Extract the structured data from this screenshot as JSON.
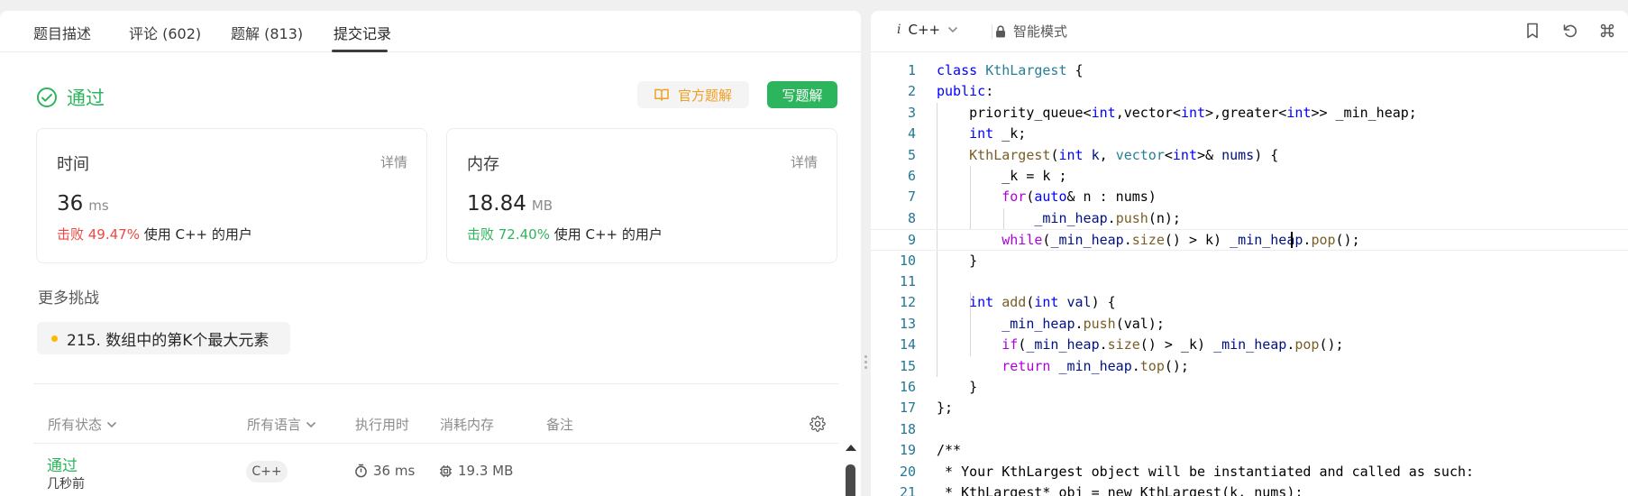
{
  "tabs": [
    {
      "label": "题目描述",
      "active": false
    },
    {
      "label": "评论 (602)",
      "active": false
    },
    {
      "label": "题解 (813)",
      "active": false
    },
    {
      "label": "提交记录",
      "active": true
    }
  ],
  "result": {
    "status": "通过",
    "official_solution_label": "官方题解",
    "write_solution_label": "写题解"
  },
  "stats": {
    "time": {
      "title": "时间",
      "detail": "详情",
      "value": "36",
      "unit": "ms",
      "beat": "击败 49.47%",
      "beat_suffix": " 使用 C++ 的用户"
    },
    "memory": {
      "title": "内存",
      "detail": "详情",
      "value": "18.84",
      "unit": "MB",
      "beat": "击败 72.40%",
      "beat_suffix": " 使用 C++ 的用户"
    }
  },
  "more_challenges": {
    "title": "更多挑战",
    "items": [
      "215. 数组中的第K个最大元素"
    ]
  },
  "submissions": {
    "headers": {
      "status": "所有状态",
      "language": "所有语言",
      "runtime": "执行用时",
      "memory": "消耗内存",
      "notes": "备注"
    },
    "rows": [
      {
        "status": "通过",
        "time_ago": "几秒前",
        "language": "C++",
        "runtime": "36 ms",
        "memory": "19.3 MB"
      }
    ]
  },
  "editor": {
    "language_icon_text": "i",
    "language": "C++",
    "mode": "智能模式",
    "line_numbers": [
      "1",
      "2",
      "3",
      "4",
      "5",
      "6",
      "7",
      "8",
      "9",
      "10",
      "11",
      "12",
      "13",
      "14",
      "15",
      "16",
      "17",
      "18",
      "19",
      "20",
      "21"
    ]
  },
  "colors": {
    "accent_green": "#2db55d",
    "beat_red": "#ef4743",
    "official_orange": "#f0a020",
    "line_number": "#237893"
  }
}
